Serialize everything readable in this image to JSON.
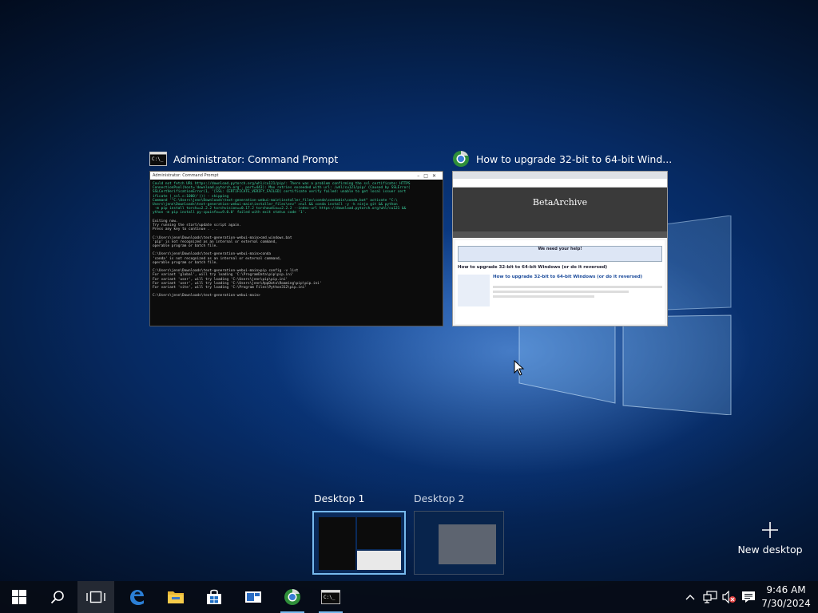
{
  "windows": [
    {
      "title": "Administrator: Command Prompt",
      "icon": "cmd-icon"
    },
    {
      "title": "How to upgrade 32-bit to 64-bit Wind...",
      "icon": "chrome-icon"
    }
  ],
  "cmd_thumbnail": {
    "titlebar": "Administrator: Command Prompt",
    "lines": [
      "Could not fetch URL https://download.pytorch.org/whl/cu121/pip/: There was a problem confirming the ssl certificate: HTTPS",
      "ConnectionPool(host='download.pytorch.org', port=443): Max retries exceeded with url: /whl/cu121/pip/ (Caused by SSLError(",
      "SSLCertVerificationError(1, '[SSL: CERTIFICATE_VERIFY_FAILED] certificate verify failed: unable to get local issuer cert",
      "ificate (_ssl.c:1000)'))) - skipping",
      "Command '\"C:\\Users\\jenn\\Downloads\\text-generation-webui-main\\installer_files\\conda\\condabin\\conda.bat\" activate \"C:\\",
      "Users\\jenn\\Downloads\\text-generation-webui-main\\installer_files\\env\" >nul && conda install -y -k ninja git && python",
      " -m pip install torch==2.2.2 torchvision==0.17.2 torchaudio==2.2.2 --index-url https://download.pytorch.org/whl/cu121 &&",
      "ython -m pip install py-cpuinfo==9.0.0' failed with exit status code '1'.",
      "",
      "Exiting now.",
      "Try running the start/update script again.",
      "Press any key to continue . . .",
      "",
      "C:\\Users\\jenn\\Downloads\\text-generation-webui-main>cmd_windows.bat",
      "'pip' is not recognized as an internal or external command,",
      "operable program or batch file.",
      "",
      "C:\\Users\\jenn\\Downloads\\text-generation-webui-main>conda",
      "'conda' is not recognized as an internal or external command,",
      "operable program or batch file.",
      "",
      "C:\\Users\\jenn\\Downloads\\text-generation-webui-main>pip config -v list",
      "For variant 'global', will try loading 'C:\\ProgramData\\pip\\pip.ini'",
      "For variant 'user', will try loading 'C:\\Users\\jenn\\pip\\pip.ini'",
      "For variant 'user', will try loading 'C:\\Users\\jenn\\AppData\\Roaming\\pip\\pip.ini'",
      "For variant 'site', will try loading 'C:\\Program Files\\Python312\\pip.ini'",
      "",
      "C:\\Users\\jenn\\Downloads\\text-generation-webui-main>"
    ]
  },
  "browser_thumbnail": {
    "site": "BetaArchive",
    "banner": "We need your help!",
    "page_title": "How to upgrade 32-bit to 64-bit Windows (or do it reversed)",
    "post_title": "How to upgrade 32-bit to 64-bit Windows (or do it reversed)"
  },
  "desktops": [
    {
      "label": "Desktop 1",
      "active": true
    },
    {
      "label": "Desktop 2",
      "active": false
    }
  ],
  "new_desktop_label": "New desktop",
  "taskbar": {
    "items": [
      "start-icon",
      "search-icon",
      "task-view-icon",
      "edge-icon",
      "file-explorer-icon",
      "store-icon",
      "app-icon",
      "chrome-icon",
      "cmd-icon"
    ],
    "time": "9:46 AM",
    "date": "7/30/2024"
  },
  "colors": {
    "accent": "#76b9ed",
    "taskbar": "#060c16"
  }
}
